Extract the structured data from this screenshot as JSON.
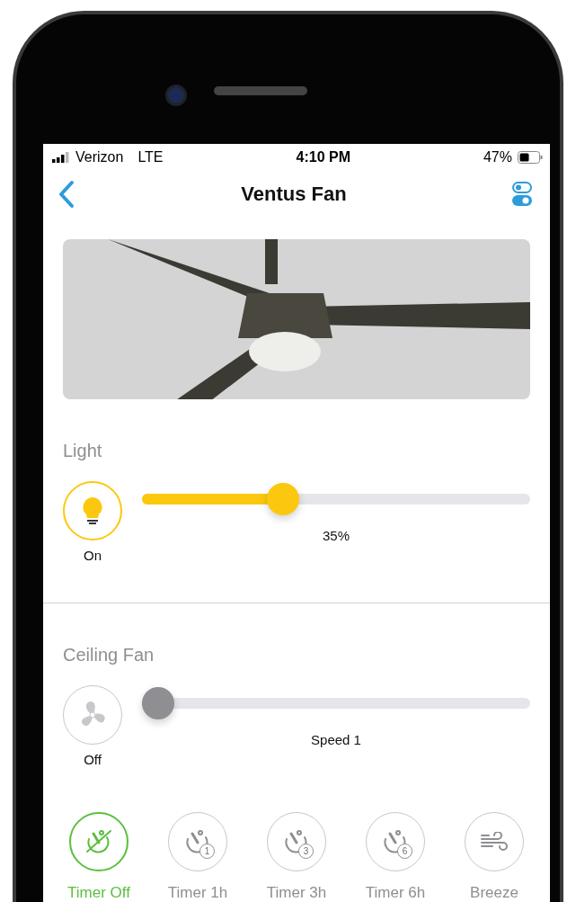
{
  "status_bar": {
    "carrier": "Verizon",
    "network": "LTE",
    "time": "4:10 PM",
    "battery": "47%"
  },
  "nav": {
    "title": "Ventus Fan"
  },
  "light": {
    "label": "Light",
    "on": true,
    "state": "On",
    "level": 0.35,
    "reading": "35%"
  },
  "fan": {
    "label": "Ceiling Fan",
    "on": false,
    "state": "Off",
    "level": 0,
    "reading": "Speed 1"
  },
  "modes": [
    {
      "kind": "timer-off",
      "label": "Timer Off",
      "selected": true
    },
    {
      "kind": "timer",
      "label": "Timer 1h",
      "badge": "1",
      "selected": false
    },
    {
      "kind": "timer",
      "label": "Timer 3h",
      "badge": "3",
      "selected": false
    },
    {
      "kind": "timer",
      "label": "Timer 6h",
      "badge": "6",
      "selected": false
    },
    {
      "kind": "breeze",
      "label": "Breeze",
      "selected": false
    }
  ]
}
